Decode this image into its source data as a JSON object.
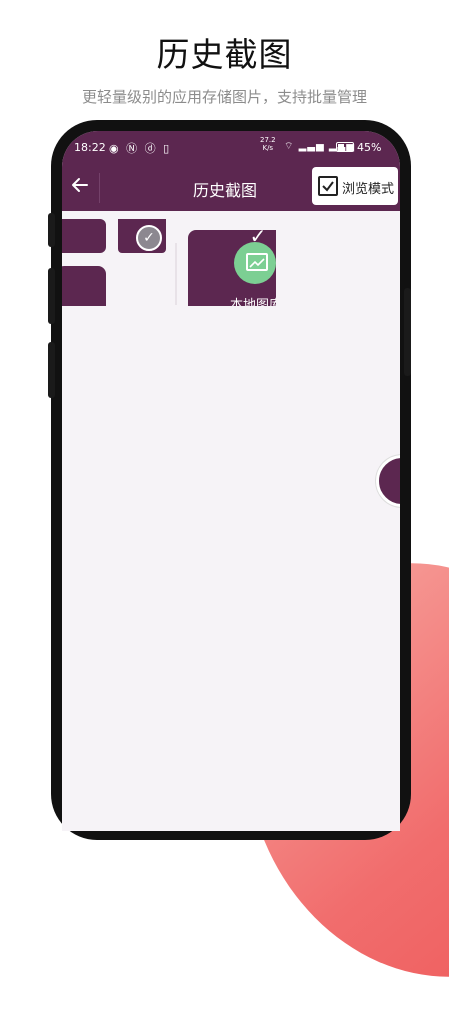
{
  "promo": {
    "title": "历史截图",
    "subtitle": "更轻量级别的应用存储图片，支持批量管理"
  },
  "status_bar": {
    "time": "18:22",
    "network_speed_value": "27.2",
    "network_speed_unit": "K/s",
    "battery_percent": "45%"
  },
  "app_bar": {
    "back_icon": "arrow-left-icon",
    "title": "历史截图",
    "browse_mode_label": "浏览模式",
    "browse_mode_checked": true
  },
  "content": {
    "selected_card_caption": "本地图库"
  },
  "colors": {
    "accent": "#5c2750",
    "background": "#f6f3f7",
    "deco_gradient_start": "#f7a6a0",
    "deco_gradient_end": "#ee5b5b"
  }
}
